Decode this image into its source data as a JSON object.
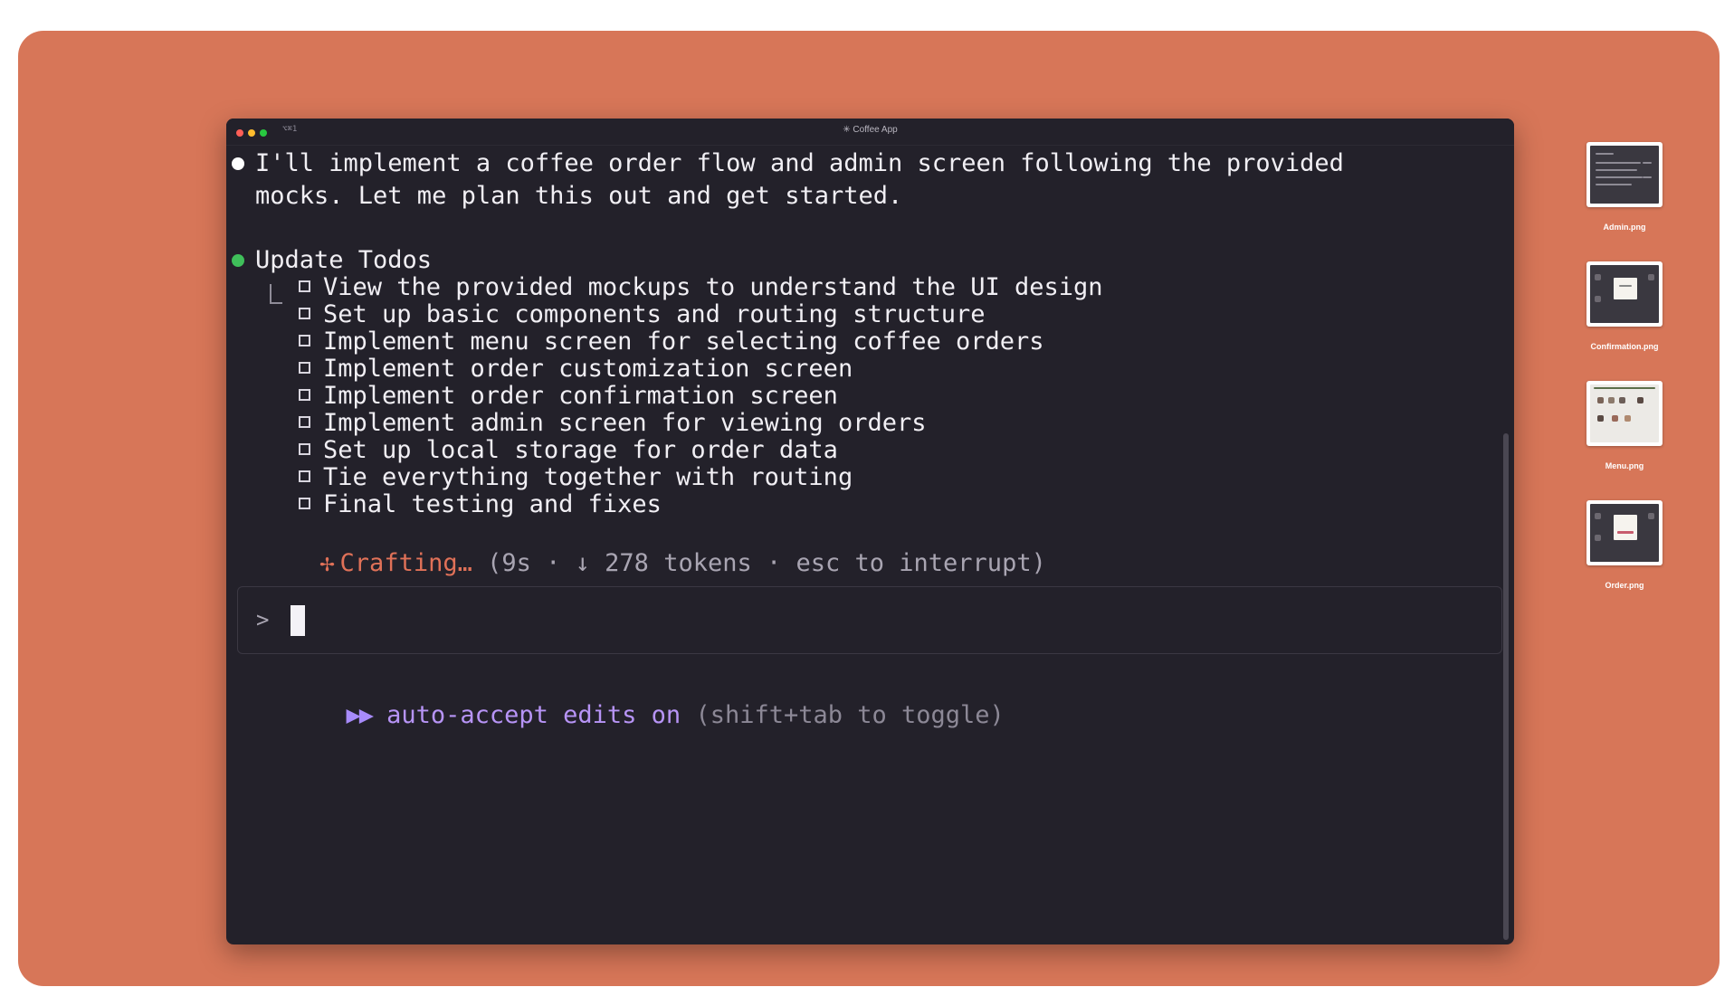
{
  "window": {
    "title": "✳ Coffee App",
    "shortcut": "⌥⌘1"
  },
  "messages": {
    "intro_line1": "I'll implement a coffee order flow and admin screen following the provided",
    "intro_line2": "mocks. Let me plan this out and get started.",
    "todos_heading": "Update Todos"
  },
  "todos": [
    {
      "label": "View the provided mockups to understand the UI design",
      "checked": false
    },
    {
      "label": "Set up basic components and routing structure",
      "checked": false
    },
    {
      "label": "Implement menu screen for selecting coffee orders",
      "checked": false
    },
    {
      "label": "Implement order customization screen",
      "checked": false
    },
    {
      "label": "Implement order confirmation screen",
      "checked": false
    },
    {
      "label": "Implement admin screen for viewing orders",
      "checked": false
    },
    {
      "label": "Set up local storage for order data",
      "checked": false
    },
    {
      "label": "Tie everything together with routing",
      "checked": false
    },
    {
      "label": "Final testing and fixes",
      "checked": false
    }
  ],
  "status": {
    "spinner": "✢",
    "action": "Crafting…",
    "detail": "(9s · ↓ 278 tokens · esc to interrupt)"
  },
  "input": {
    "prompt": ">"
  },
  "mode": {
    "arrows": "▶▶",
    "label": "auto-accept edits on",
    "hint": "(shift+tab to toggle)"
  },
  "desktop_files": [
    {
      "name": "Admin.png",
      "style": "dark"
    },
    {
      "name": "Confirmation.png",
      "style": "dark"
    },
    {
      "name": "Menu.png",
      "style": "light"
    },
    {
      "name": "Order.png",
      "style": "dark"
    }
  ],
  "colors": {
    "backdrop": "#d77658",
    "terminal_bg": "#23212a",
    "accent_orange": "#e07158",
    "accent_purple": "#b794f6",
    "status_green": "#3fbf5a"
  }
}
